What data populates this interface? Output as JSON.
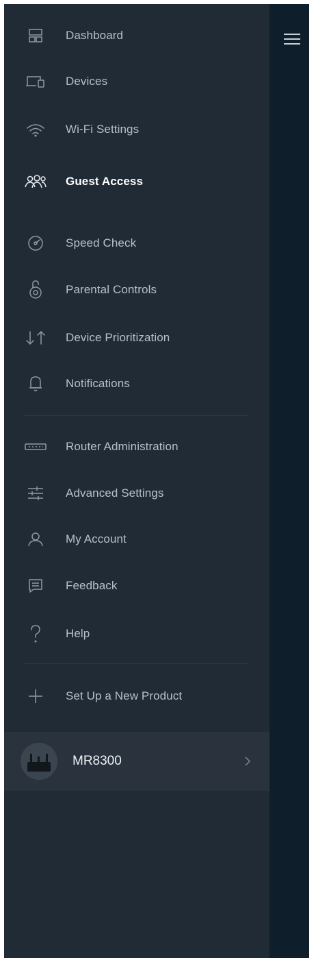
{
  "menu": {
    "items": [
      {
        "label": "Dashboard",
        "icon": "dashboard-icon"
      },
      {
        "label": "Devices",
        "icon": "devices-icon"
      },
      {
        "label": "Wi-Fi Settings",
        "icon": "wifi-icon"
      },
      {
        "label": "Guest Access",
        "icon": "guest-access-icon",
        "active": true
      },
      {
        "label": "Speed Check",
        "icon": "speed-check-icon"
      },
      {
        "label": "Parental Controls",
        "icon": "parental-controls-icon"
      },
      {
        "label": "Device Prioritization",
        "icon": "device-prioritization-icon"
      },
      {
        "label": "Notifications",
        "icon": "notifications-icon"
      },
      {
        "label": "Router Administration",
        "icon": "router-icon"
      },
      {
        "label": "Advanced Settings",
        "icon": "sliders-icon"
      },
      {
        "label": "My Account",
        "icon": "account-icon"
      },
      {
        "label": "Feedback",
        "icon": "feedback-icon"
      },
      {
        "label": "Help",
        "icon": "help-icon"
      },
      {
        "label": "Set Up a New Product",
        "icon": "plus-icon"
      }
    ]
  },
  "product": {
    "name": "MR8300"
  },
  "colors": {
    "drawer_bg": "#212b36",
    "backdrop_bg": "#0f1e2b",
    "active_text": "#ffffff",
    "text": "#b7c0c8",
    "icon": "#8e99a4"
  }
}
